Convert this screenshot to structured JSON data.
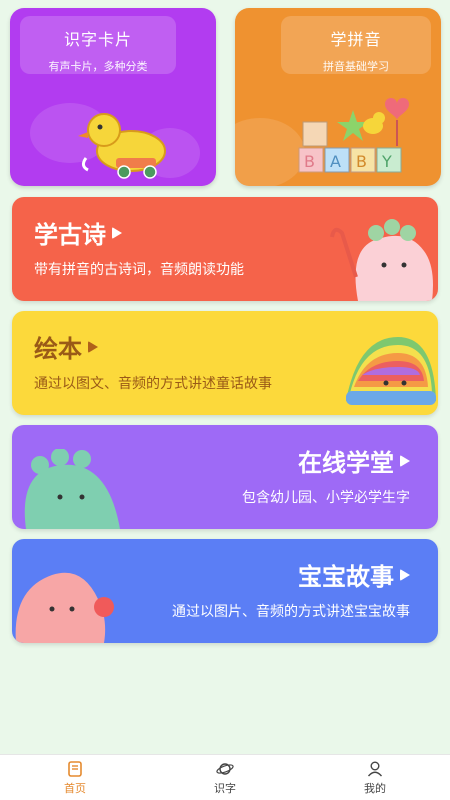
{
  "cards_top": [
    {
      "title": "识字卡片",
      "subtitle": "有声卡片，多种分类",
      "color": "#b23cf0",
      "icon": "duck-toy-icon"
    },
    {
      "title": "学拼音",
      "subtitle": "拼音基础学习",
      "color": "#ef9230",
      "icon": "baby-blocks-icon"
    }
  ],
  "cards": [
    {
      "title": "学古诗",
      "subtitle": "带有拼音的古诗词，音频朗读功能",
      "color": "#f5634a",
      "icon": "play-icon"
    },
    {
      "title": "绘本",
      "subtitle": "通过以图文、音频的方式讲述童话故事",
      "color": "#fcd93b",
      "icon": "play-icon"
    },
    {
      "title": "在线学堂",
      "subtitle": "包含幼儿园、小学必学生字",
      "color": "#9e6af6",
      "icon": "play-icon"
    },
    {
      "title": "宝宝故事",
      "subtitle": "通过以图片、音频的方式讲述宝宝故事",
      "color": "#5b7ef5",
      "icon": "play-icon"
    }
  ],
  "tabbar": [
    {
      "label": "首页",
      "icon": "home-book-icon",
      "active": true
    },
    {
      "label": "识字",
      "icon": "planet-icon",
      "active": false
    },
    {
      "label": "我的",
      "icon": "user-icon",
      "active": false
    }
  ],
  "accent_color": "#e58a2f"
}
